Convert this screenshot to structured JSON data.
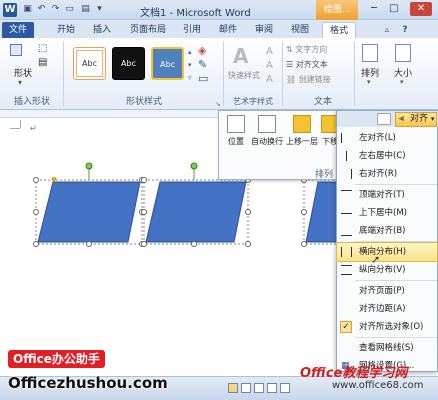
{
  "titlebar": {
    "app_icon": "W",
    "title": "文档1 - Microsoft Word",
    "context_tools": "绘图...",
    "qat_icons": [
      "save-icon",
      "undo-icon",
      "redo-icon",
      "open-icon",
      "print-icon"
    ]
  },
  "tabs": [
    {
      "label": "文件"
    },
    {
      "label": "开始"
    },
    {
      "label": "插入"
    },
    {
      "label": "页面布局"
    },
    {
      "label": "引用"
    },
    {
      "label": "邮件"
    },
    {
      "label": "审阅"
    },
    {
      "label": "视图"
    },
    {
      "label": "格式"
    }
  ],
  "ribbon": {
    "insert_shapes": {
      "button": "形状",
      "label": "插入形状"
    },
    "shape_styles": {
      "styles": [
        "Abc",
        "Abc",
        "Abc"
      ],
      "label": "形状样式"
    },
    "wordart": {
      "button": "快速样式",
      "label": "艺术字样式"
    },
    "text": {
      "items": [
        "文字方向",
        "对齐文本",
        "创建链接"
      ],
      "label": "文本"
    },
    "arrange": {
      "button": "排列"
    },
    "size": {
      "button": "大小"
    }
  },
  "arrange_dropdown": {
    "buttons": [
      "位置",
      "自动换行",
      "上移一层",
      "下移"
    ],
    "label": "排列"
  },
  "align_menu": {
    "button": "对齐",
    "items": [
      {
        "label": "左对齐(L)",
        "icon": "align-left-icon"
      },
      {
        "label": "左右居中(C)",
        "icon": "align-center-icon"
      },
      {
        "label": "右对齐(R)",
        "icon": "align-right-icon"
      },
      {
        "label": "顶端对齐(T)",
        "icon": "align-top-icon"
      },
      {
        "label": "上下居中(M)",
        "icon": "align-middle-icon"
      },
      {
        "label": "底端对齐(B)",
        "icon": "align-bottom-icon"
      },
      {
        "label": "横向分布(H)",
        "icon": "distribute-horizontal-icon",
        "highlighted": true
      },
      {
        "label": "纵向分布(V)",
        "icon": "distribute-vertical-icon"
      },
      {
        "label": "对齐页面(P)"
      },
      {
        "label": "对齐边距(A)"
      },
      {
        "label": "对齐所选对象(O)",
        "checked": true
      },
      {
        "label": "查看网格线(S)"
      },
      {
        "label": "网格设置(G)..."
      }
    ]
  },
  "watermarks": {
    "badge": "Office办公助手",
    "site": "Officezhushou.com",
    "right_brand": "Office教程学习网",
    "right_url": "www.office68.com"
  },
  "colors": {
    "accent": "#2c5aa0",
    "shape_fill": "#4472c4",
    "highlight": "#fde48a",
    "badge": "#e21f26"
  }
}
